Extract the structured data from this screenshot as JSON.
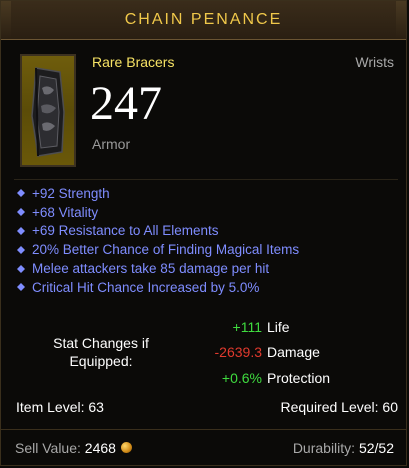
{
  "item": {
    "name": "CHAIN PENANCE",
    "type_line": "Rare Bracers",
    "slot": "Wrists",
    "armor_value": "247",
    "armor_label": "Armor",
    "icon": "bracer-icon"
  },
  "affixes": [
    "+92 Strength",
    "+68 Vitality",
    "+69 Resistance to All Elements",
    "20% Better Chance of Finding Magical Items",
    "Melee attackers take 85 damage per hit",
    "Critical Hit Chance Increased by 5.0%"
  ],
  "stat_changes": {
    "title_line1": "Stat Changes if",
    "title_line2": "Equipped:",
    "rows": [
      {
        "value": "+111",
        "name": "Life"
      },
      {
        "value": "-2639.3",
        "name": "Damage"
      },
      {
        "value": "+0.6%",
        "name": "Protection"
      }
    ]
  },
  "levels": {
    "item_level": "Item Level: 63",
    "required_level": "Required Level: 60"
  },
  "footer": {
    "sell_label": "Sell Value:",
    "sell_value": "2468",
    "durability_label": "Durability:",
    "durability_value": "52/52"
  },
  "colors": {
    "title_gold": "#f0c84a",
    "rare_yellow": "#f7e365",
    "affix_blue": "#7f8dff",
    "positive_green": "#3fdc3f",
    "negative_red": "#e03a2e"
  }
}
